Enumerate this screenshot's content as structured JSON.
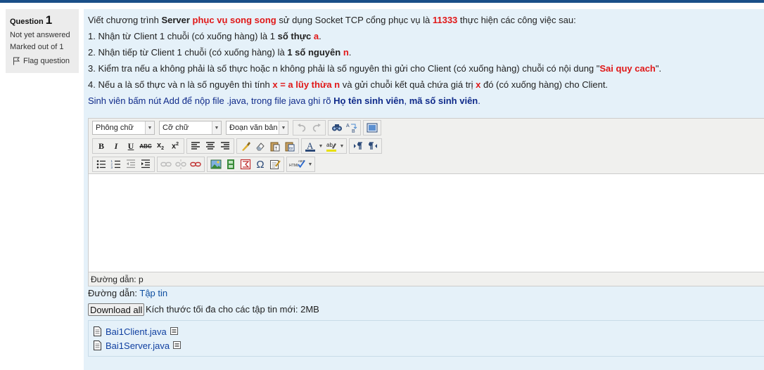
{
  "info": {
    "question_label": "Question",
    "question_number": "1",
    "state": "Not yet answered",
    "grade": "Marked out of 1",
    "flag_label": "Flag question"
  },
  "question": {
    "l1_a": "Viết chương trình ",
    "l1_b": "Server",
    "l1_c": " ",
    "l1_d": "phục vụ song song",
    "l1_e": " sử dụng Socket TCP cổng phục vụ là ",
    "l1_f": "11333",
    "l1_g": " thực hiện các công việc sau:",
    "l2_a": "1. Nhận từ Client 1 chuỗi (có xuống hàng) là 1 ",
    "l2_b": "số thực",
    "l2_c": " ",
    "l2_d": "a",
    "l2_e": ".",
    "l3_a": "2. Nhận tiếp từ Client 1 chuỗi (có xuống hàng) là ",
    "l3_b": "1 số nguyên",
    "l3_c": " ",
    "l3_d": "n",
    "l3_e": ".",
    "l4_a": "3. Kiểm tra nếu a không phải là số thực hoặc n không phải là số nguyên thì gửi cho Client (có xuống hàng) chuỗi có nội dung  \"",
    "l4_b": "Sai quy cach",
    "l4_c": "\".",
    "l5_a": "4. Nếu a là số thực và n là số nguyên thì tính ",
    "l5_b": "x = a lũy thừa n",
    "l5_c": " và gửi chuỗi kết quả chứa giá trị ",
    "l5_d": "x",
    "l5_e": " đó (có xuống hàng) cho Client.",
    "l6_a": "Sinh viên bấm nút Add để nộp file .java, trong file java ghi rõ ",
    "l6_b": "Họ tên sinh viên",
    "l6_c": ", ",
    "l6_d": "mã số sinh viên",
    "l6_e": "."
  },
  "editor": {
    "font_family": "Phông chữ",
    "font_size": "Cỡ chữ",
    "format": "Đoạn văn bản",
    "path_label": "Đường dẫn: p"
  },
  "filemanager": {
    "path_label": "Đường dẫn: ",
    "path_link": "Tập tin",
    "download_all": "Download all",
    "max_size": "Kích thước tối đa cho các tập tin mới: 2MB",
    "files": [
      "Bai1Client.java",
      "Bai1Server.java"
    ]
  },
  "colors": {
    "accent": "#1a4f88",
    "highlight": "#e01818",
    "note": "#0f2a8a",
    "panel": "#e5f1f9",
    "info_bg": "#ececec"
  },
  "icons": [
    "flag-icon",
    "bold-icon",
    "italic-icon",
    "underline-icon",
    "strikethrough-icon",
    "subscript-icon",
    "superscript-icon",
    "align-left-icon",
    "align-center-icon",
    "align-right-icon",
    "cleanup-icon",
    "remove-format-icon",
    "paste-text-icon",
    "paste-word-icon",
    "text-color-icon",
    "highlight-color-icon",
    "ltr-icon",
    "rtl-icon",
    "bullet-list-icon",
    "numbered-list-icon",
    "outdent-icon",
    "indent-icon",
    "link-icon",
    "unlink-icon",
    "nolink-icon",
    "image-icon",
    "media-icon",
    "equation-icon",
    "special-char-icon",
    "source-edit-icon",
    "spellcheck-icon",
    "undo-icon",
    "redo-icon",
    "search-icon",
    "replace-icon",
    "fullscreen-icon",
    "file-icon",
    "file-menu-icon"
  ]
}
